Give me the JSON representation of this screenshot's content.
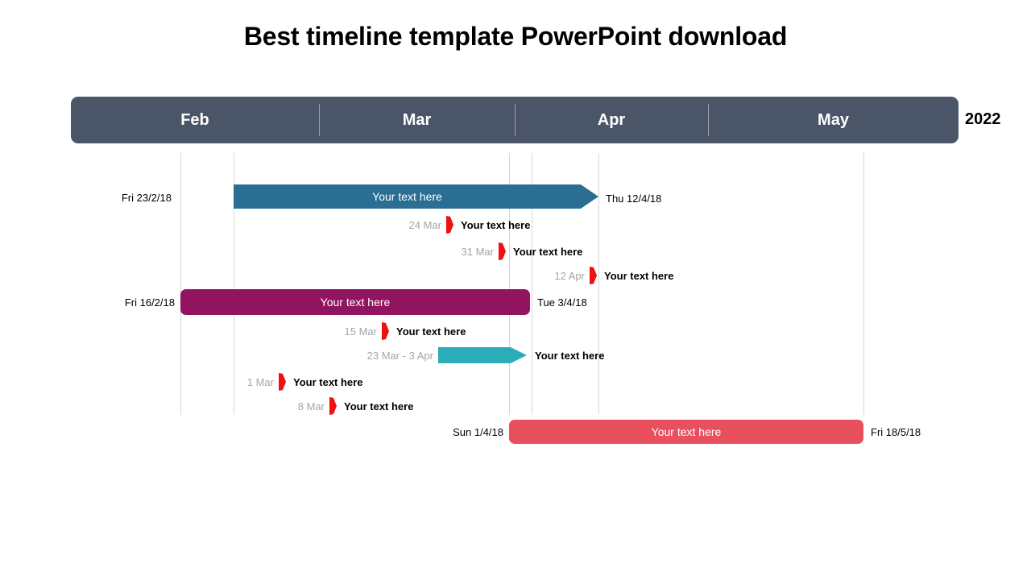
{
  "title": "Best timeline template PowerPoint download",
  "colors": {
    "header_bar": "#4a5568",
    "gridline": "#d6d6d6",
    "bar_blue": "#2a6f93",
    "bar_purple": "#911460",
    "bar_teal": "#2aadb8",
    "bar_red": "#e8505f",
    "milestone_red": "#ee1111",
    "milestone_date": "#a6a6a6",
    "background": "#ffffff",
    "text": "#000000"
  },
  "axis": {
    "year": "2022",
    "months": [
      {
        "label": "Feb"
      },
      {
        "label": "Mar"
      },
      {
        "label": "Apr"
      },
      {
        "label": "May"
      }
    ]
  },
  "tasks": [
    {
      "kind": "arrow-bar",
      "label": "Your text here",
      "start_date": "Fri 23/2/18",
      "end_date": "Thu 12/4/18",
      "color": "#2a6f93"
    },
    {
      "kind": "bar",
      "label": "Your text here",
      "start_date": "Fri 16/2/18",
      "end_date": "Tue 3/4/18",
      "color": "#911460"
    },
    {
      "kind": "arrow-bar",
      "label": "Your text here",
      "date_range": "23 Mar - 3 Apr",
      "color": "#2aadb8"
    },
    {
      "kind": "bar",
      "label": "Your text here",
      "start_date": "Sun 1/4/18",
      "end_date": "Fri 18/5/18",
      "color": "#e8505f"
    }
  ],
  "milestones": [
    {
      "date": "24 Mar",
      "label": "Your text here"
    },
    {
      "date": "31 Mar",
      "label": "Your text here"
    },
    {
      "date": "12 Apr",
      "label": "Your text here"
    },
    {
      "date": "15 Mar",
      "label": "Your text here"
    },
    {
      "date": "1 Mar",
      "label": "Your text here"
    },
    {
      "date": "8 Mar",
      "label": "Your text here"
    }
  ]
}
